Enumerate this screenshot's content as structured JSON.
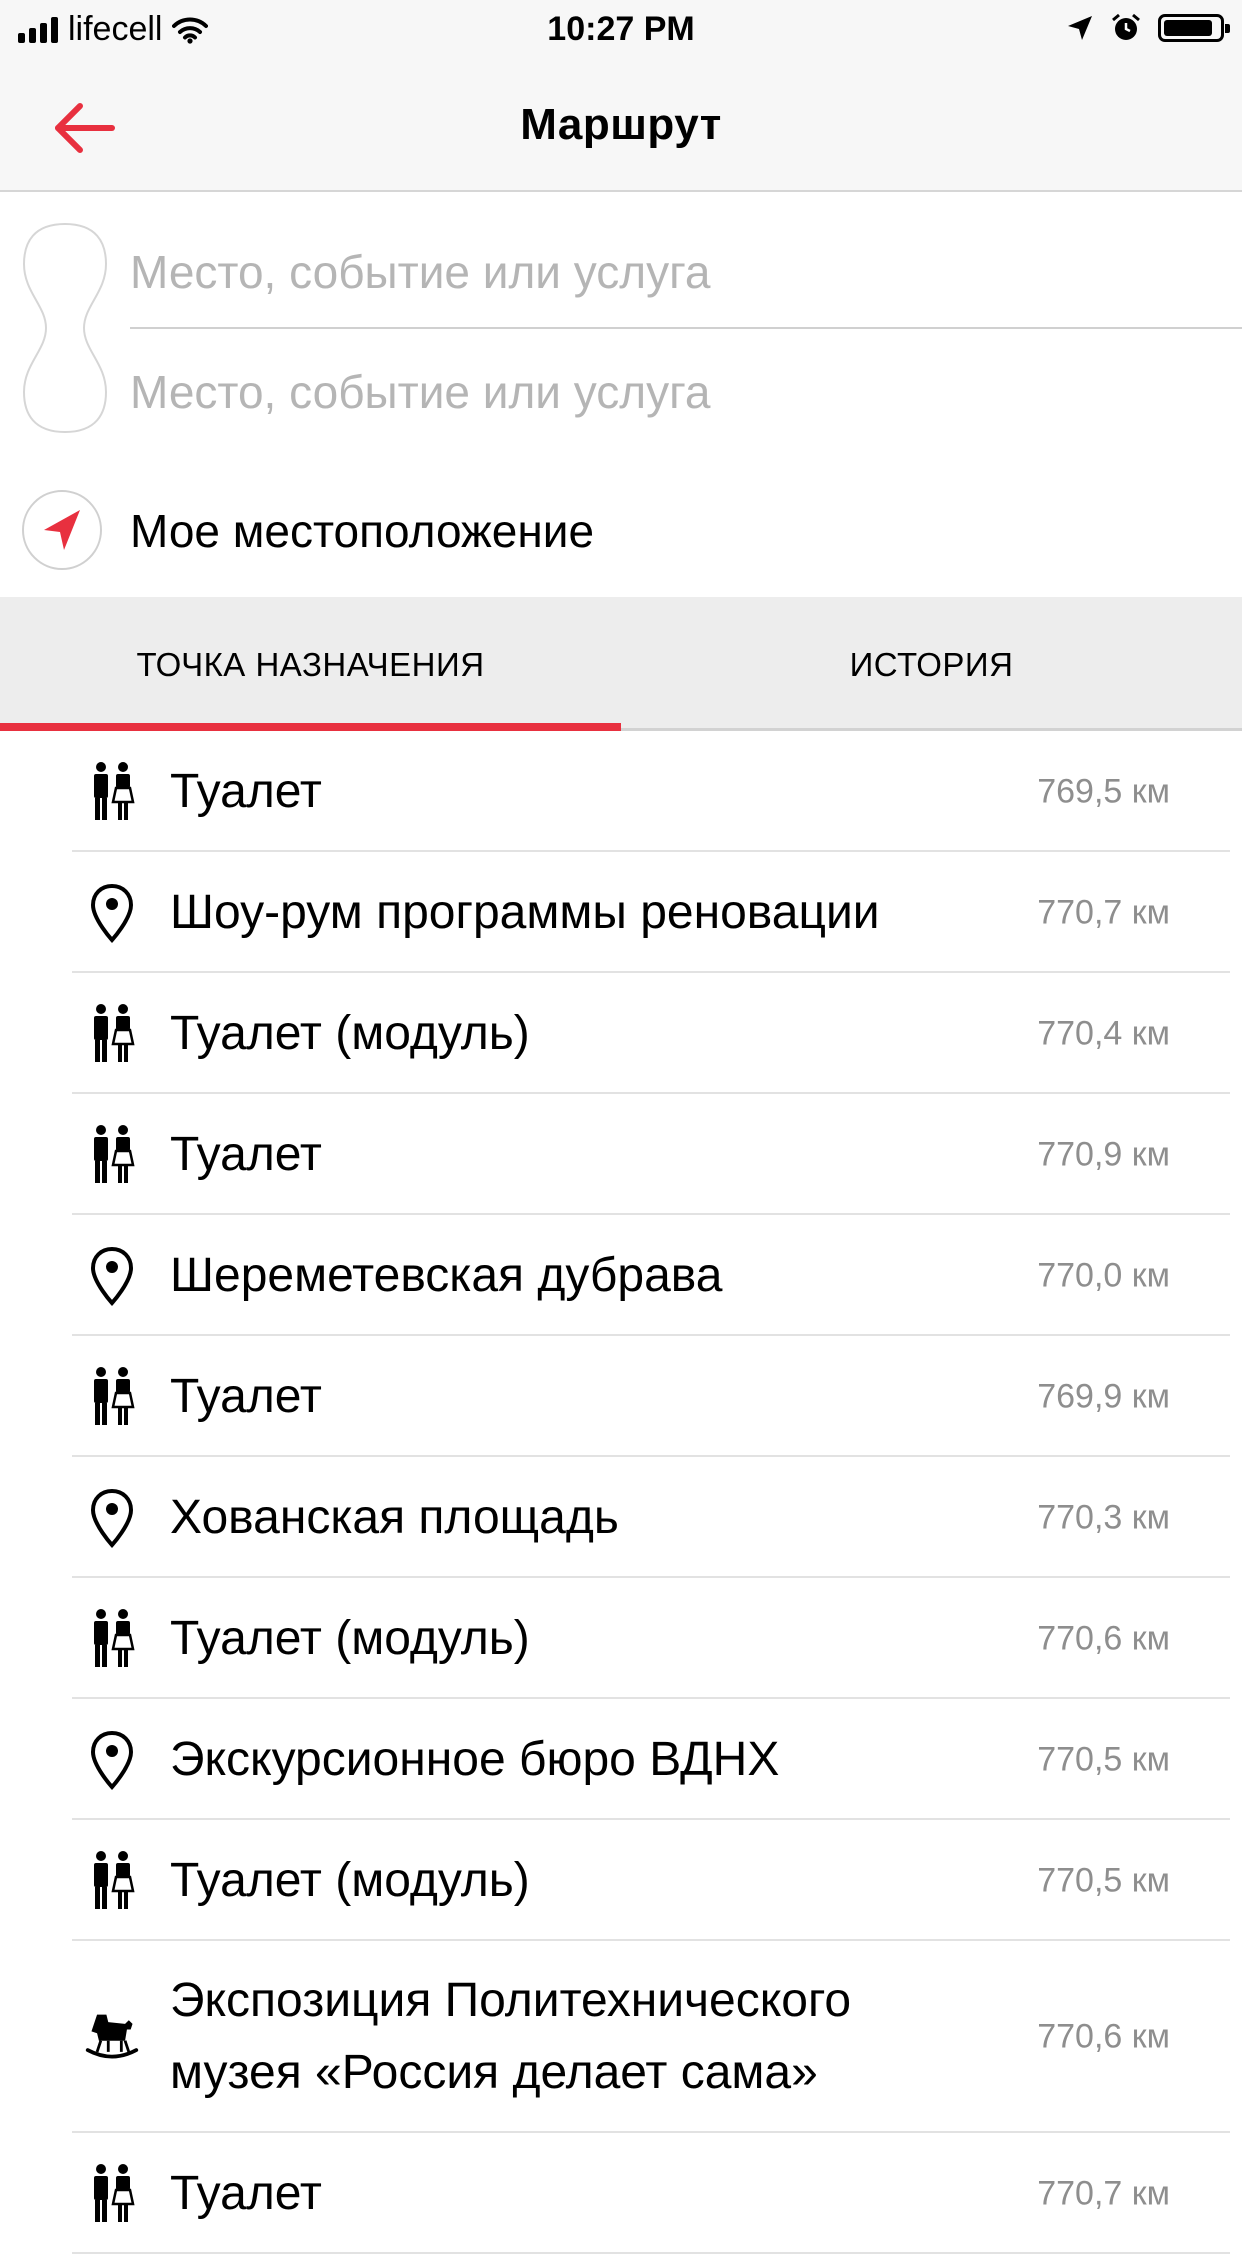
{
  "status_bar": {
    "carrier": "lifecell",
    "time": "10:27 PM"
  },
  "nav": {
    "title": "Маршрут"
  },
  "route_inputs": {
    "from_placeholder": "Место, событие или услуга",
    "to_placeholder": "Место, событие или услуга",
    "my_location_label": "Мое местоположение"
  },
  "tabs": [
    {
      "label": "ТОЧКА НАЗНАЧЕНИЯ",
      "active": true
    },
    {
      "label": "ИСТОРИЯ",
      "active": false
    }
  ],
  "accent_color": "#e8303f",
  "destinations": [
    {
      "icon": "restroom-icon",
      "name": "Туалет",
      "distance": "769,5 км"
    },
    {
      "icon": "map-pin-icon",
      "name": "Шоу-рум программы реновации",
      "distance": "770,7 км"
    },
    {
      "icon": "restroom-icon",
      "name": "Туалет (модуль)",
      "distance": "770,4 км"
    },
    {
      "icon": "restroom-icon",
      "name": "Туалет",
      "distance": "770,9 км"
    },
    {
      "icon": "map-pin-icon",
      "name": "Шереметевская дубрава",
      "distance": "770,0 км"
    },
    {
      "icon": "restroom-icon",
      "name": "Туалет",
      "distance": "769,9 км"
    },
    {
      "icon": "map-pin-icon",
      "name": "Хованская площадь",
      "distance": "770,3 км"
    },
    {
      "icon": "restroom-icon",
      "name": "Туалет (модуль)",
      "distance": "770,6 км"
    },
    {
      "icon": "map-pin-icon",
      "name": "Экскурсионное бюро ВДНХ",
      "distance": "770,5 км"
    },
    {
      "icon": "restroom-icon",
      "name": "Туалет (модуль)",
      "distance": "770,5 км"
    },
    {
      "icon": "rocking-horse-icon",
      "name": "Экспозиция Политехнического музея «Россия делает сама»",
      "distance": "770,6 км"
    },
    {
      "icon": "restroom-icon",
      "name": "Туалет",
      "distance": "770,7 км"
    }
  ]
}
